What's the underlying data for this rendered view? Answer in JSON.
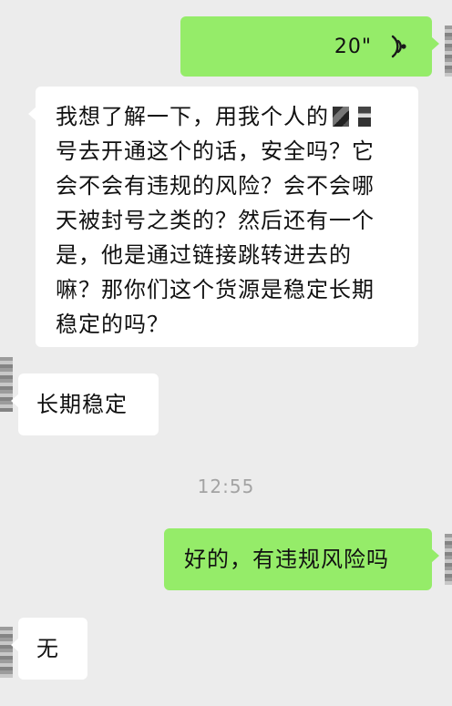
{
  "messages": {
    "voice": {
      "duration": "20\""
    },
    "long_question": {
      "lines": [
        "我想了解一下，用我个人的",
        "号去开通这个的话，安全吗？它",
        "会不会有违规的风险？会不会哪",
        "天被封号之类的？然后还有一个",
        "是，他是通过链接跳转进去的",
        "嘛？那你们这个货源是稳定长期",
        "稳定的吗？"
      ]
    },
    "reply_stable": "长期稳定",
    "timestamp": "12:55",
    "question_ok": "好的，有违规风险吗",
    "reply_none": "无"
  },
  "colors": {
    "background": "#ececec",
    "sent_bubble": "#95ec69",
    "received_bubble": "#ffffff",
    "timestamp_text": "#a3a3a3"
  },
  "icons": {
    "voice": "voice-wave-icon"
  }
}
